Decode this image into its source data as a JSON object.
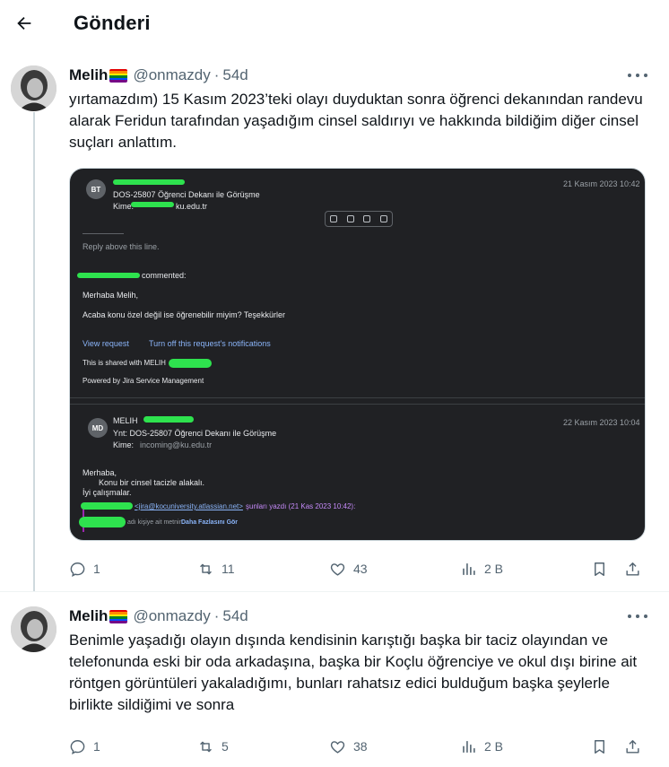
{
  "header": {
    "title": "Gönderi"
  },
  "tweets": [
    {
      "name": "Melih",
      "handle": "@onmazdy",
      "dot": "·",
      "time": "54d",
      "text": "yırtamazdım) 15 Kasım 2023’teki olayı duyduktan sonra öğrenci dekanından randevu alarak Feridun tarafından yaşadığım cinsel saldırıyı ve hakkında bildiğim diğer cinsel suçları anlattım.",
      "replies": "1",
      "reposts": "11",
      "likes": "43",
      "views": "2 B"
    },
    {
      "name": "Melih",
      "handle": "@onmazdy",
      "dot": "·",
      "time": "54d",
      "text": "Benimle yaşadığı olayın dışında kendisinin karıştığı başka bir taciz olayından ve telefonunda eski bir oda arkadaşına, başka bir Koçlu öğrenciye ve okul dışı birine ait röntgen görüntüleri yakaladığımı, bunları rahatsız edici bulduğum başka şeylerle birlikte sildiğimi ve sonra",
      "replies": "1",
      "reposts": "5",
      "likes": "38",
      "views": "2 B"
    }
  ],
  "email": {
    "msg1": {
      "avatar": "BT",
      "subject": "DOS-25807 Öğrenci Dekanı ile Görüşme",
      "to_label": "Kime:",
      "to_suffix": "ku.edu.tr",
      "date": "21 Kasım 2023 10:42",
      "reply_above": "Reply above this line.",
      "commented": "commented:",
      "greeting": "Merhaba Melih,",
      "question": "Acaba konu özel değil ise öğrenebilir miyim? Teşekkürler",
      "view_request": "View request",
      "turn_off": "Turn off this request's notifications",
      "shared_with": "This is shared with MELIH",
      "powered_by": "Powered by Jira Service Management"
    },
    "msg2": {
      "avatar": "MD",
      "sender": "MELIH",
      "subject": "Ynt: DOS-25807 Öğrenci Dekanı ile Görüşme",
      "to_label": "Kime:",
      "to_address": "incoming@ku.edu.tr",
      "date": "22 Kasım 2023 10:04",
      "body_1": "Merhaba,",
      "body_2": "Konu bir cinsel tacizle alakalı.",
      "body_3": "İyi çalışmalar.",
      "quote_address": "<jira@kocuniversity.atlassian.net>",
      "quote_suffix": "şunları yazdı (21 Kas 2023 10:42):",
      "quote_more_prefix": "adı kişiye ait metnin",
      "quote_more_link": "Daha Fazlasını Gör"
    }
  },
  "colors": {
    "accent": "#1d9bf0",
    "text": "#0f1419",
    "muted": "#536471",
    "border": "#eff3f4",
    "redaction": "#2ee24e"
  }
}
